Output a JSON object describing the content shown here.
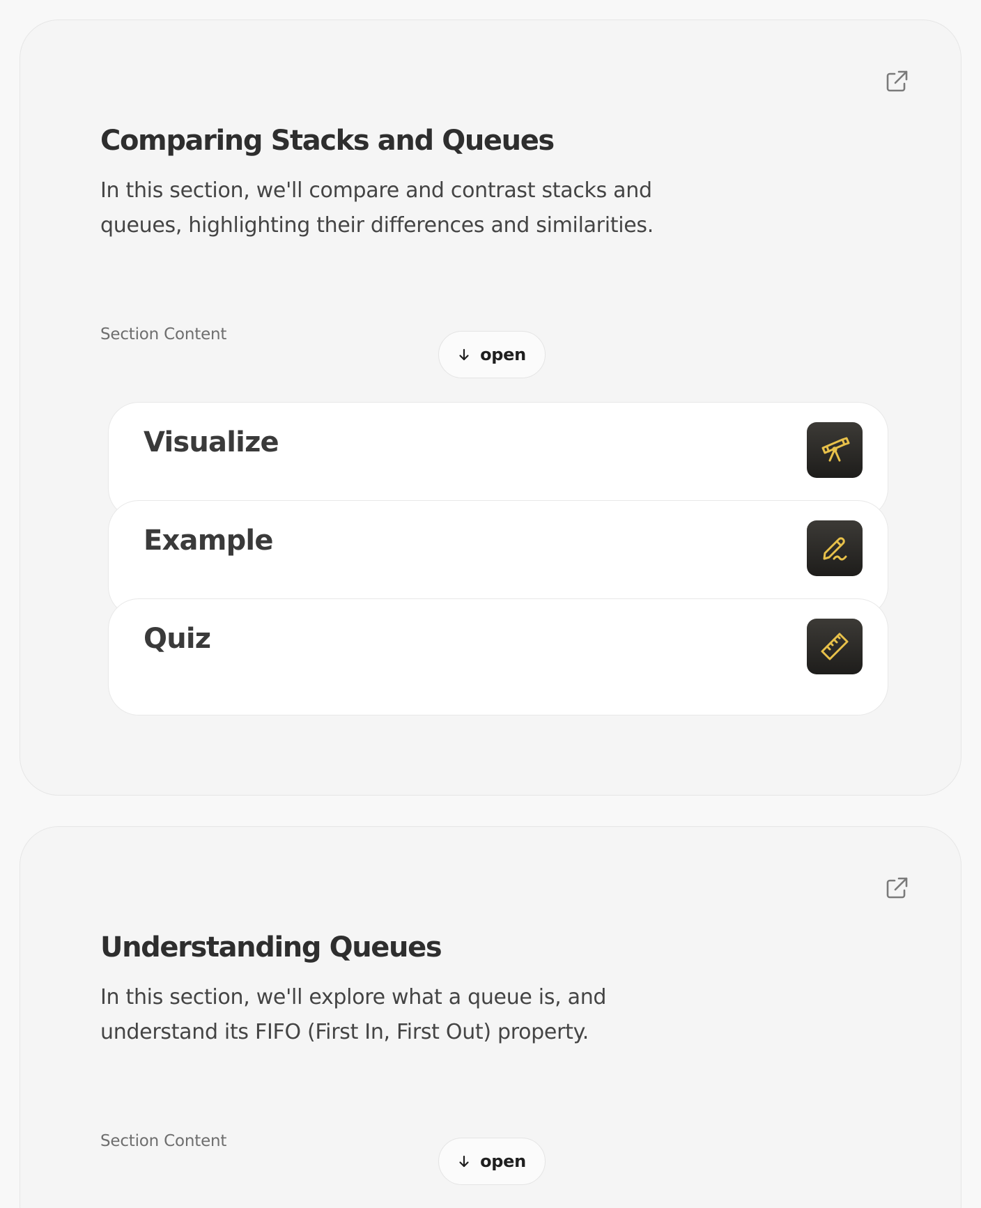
{
  "colors": {
    "icon_gold": "#e8c14a",
    "icon_tile": "#2a2926",
    "card_bg": "#f5f5f5",
    "item_bg": "#ffffff"
  },
  "sections": [
    {
      "title": "Comparing Stacks and Queues",
      "description": "In this section, we'll compare and contrast stacks and queues, highlighting their differences and similarities.",
      "content_label": "Section Content",
      "open_button": {
        "label": "open",
        "icon": "arrow-down-icon"
      },
      "external_icon": "external-link-icon",
      "items": [
        {
          "label": "Visualize",
          "icon": "telescope-icon"
        },
        {
          "label": "Example",
          "icon": "pen-icon"
        },
        {
          "label": "Quiz",
          "icon": "ruler-icon"
        }
      ]
    },
    {
      "title": "Understanding Queues",
      "description": "In this section, we'll explore what a queue is, and understand its FIFO (First In, First Out) property.",
      "content_label": "Section Content",
      "open_button": {
        "label": "open",
        "icon": "arrow-down-icon"
      },
      "external_icon": "external-link-icon"
    }
  ]
}
